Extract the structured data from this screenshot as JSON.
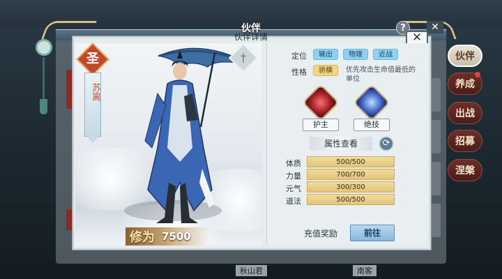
{
  "header": {
    "title": "伙伴",
    "subtitle": "伙伴详情",
    "help_label": "?",
    "close_label": "✕"
  },
  "side_tabs": [
    {
      "label": "伙伴",
      "active": true
    },
    {
      "label": "养成",
      "active": false,
      "badge": true
    },
    {
      "label": "出战",
      "active": false
    },
    {
      "label": "招募",
      "active": false
    },
    {
      "label": "涅槃",
      "active": false
    }
  ],
  "character": {
    "rank_badge": "圣",
    "name": "苏离",
    "weapon_icon": "sword-icon",
    "power_label": "修为",
    "power_value": "7500"
  },
  "info": {
    "position_label": "定位",
    "roles": [
      "输出",
      "物理",
      "近战"
    ],
    "personality_label": "性格",
    "personality": "骄横",
    "personality_desc": "优先攻击生命值最低的单位",
    "skills": [
      {
        "name": "护主",
        "icon": "red-skill-icon"
      },
      {
        "name": "绝技",
        "icon": "blue-skill-icon"
      }
    ],
    "attr_title": "属性查看",
    "stats": [
      {
        "label": "体质",
        "value": "500/500"
      },
      {
        "label": "力量",
        "value": "700/700"
      },
      {
        "label": "元气",
        "value": "300/300"
      },
      {
        "label": "道法",
        "value": "500/500"
      }
    ],
    "recharge_label": "充值奖励",
    "go_label": "前往"
  },
  "background": {
    "bottom_names": [
      "秋山君",
      "南客"
    ]
  },
  "colors": {
    "accent_gold": "#e9b36a",
    "tab_red": "#6e2e28",
    "chip_blue": "#8fd1f0",
    "stat_gold": "#f1dc9c"
  }
}
